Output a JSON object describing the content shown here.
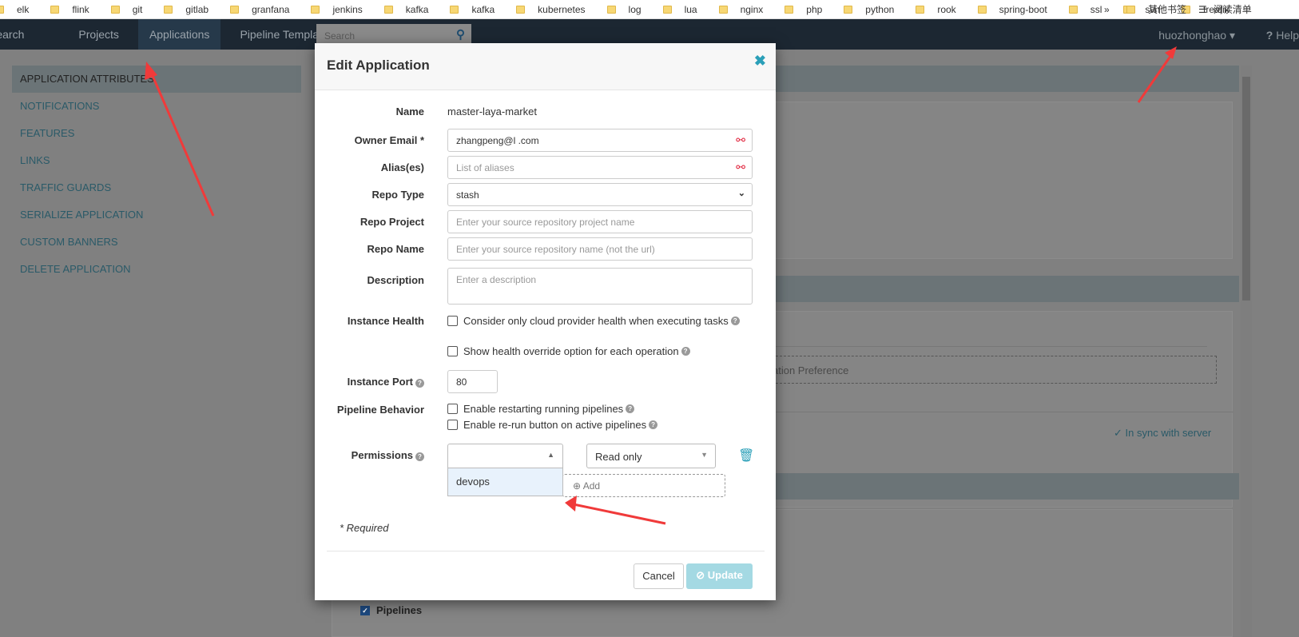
{
  "bookmarks": [
    "elk",
    "flink",
    "git",
    "gitlab",
    "granfana",
    "jenkins",
    "kafka",
    "kafka",
    "kubernetes",
    "log",
    "lua",
    "nginx",
    "php",
    "python",
    "rook",
    "spring-boot",
    "ssl",
    "svn",
    "treafik"
  ],
  "bookmarks_more": "»",
  "bookmarks_other": "其他书签",
  "reading_list": "阅读清单",
  "nav": {
    "items": [
      "Search",
      "Projects",
      "Applications",
      "Pipeline Templates"
    ],
    "active": "Applications",
    "search_placeholder": "Search",
    "user": "huozhonghao",
    "help": "Help"
  },
  "sidebar": {
    "items": [
      "APPLICATION ATTRIBUTES",
      "NOTIFICATIONS",
      "FEATURES",
      "LINKS",
      "TRAFFIC GUARDS",
      "SERIALIZE APPLICATION",
      "CUSTOM BANNERS",
      "DELETE APPLICATION"
    ]
  },
  "background": {
    "preference_text": "ation Preference",
    "sync_status": "In sync with server",
    "pipelines_label": "Pipelines"
  },
  "modal": {
    "title": "Edit Application",
    "name_label": "Name",
    "name_value": "master-laya-market",
    "owner_label": "Owner Email *",
    "owner_value": "zhangpeng@l     .com",
    "alias_label": "Alias(es)",
    "alias_placeholder": "List of aliases",
    "repo_type_label": "Repo Type",
    "repo_type_value": "stash",
    "repo_project_label": "Repo Project",
    "repo_project_placeholder": "Enter your source repository project name",
    "repo_name_label": "Repo Name",
    "repo_name_placeholder": "Enter your source repository name (not the url)",
    "description_label": "Description",
    "description_placeholder": "Enter a description",
    "instance_health_label": "Instance Health",
    "health_opt1": "Consider only cloud provider health when executing tasks",
    "health_opt2": "Show health override option for each operation",
    "instance_port_label": "Instance Port",
    "instance_port_value": "80",
    "pipeline_behavior_label": "Pipeline Behavior",
    "pipeline_opt1": "Enable restarting running pipelines",
    "pipeline_opt2": "Enable re-run button on active pipelines",
    "permissions_label": "Permissions",
    "permission_group_option": "devops",
    "permission_access": "Read only",
    "add_label": "Add",
    "required_note": "* Required",
    "cancel": "Cancel",
    "update": "Update"
  },
  "colors": {
    "accent": "#2a9fb8",
    "nav_bg": "#1c2732",
    "lock": "#e0213a",
    "annotation_arrow": "#f03a3a"
  }
}
